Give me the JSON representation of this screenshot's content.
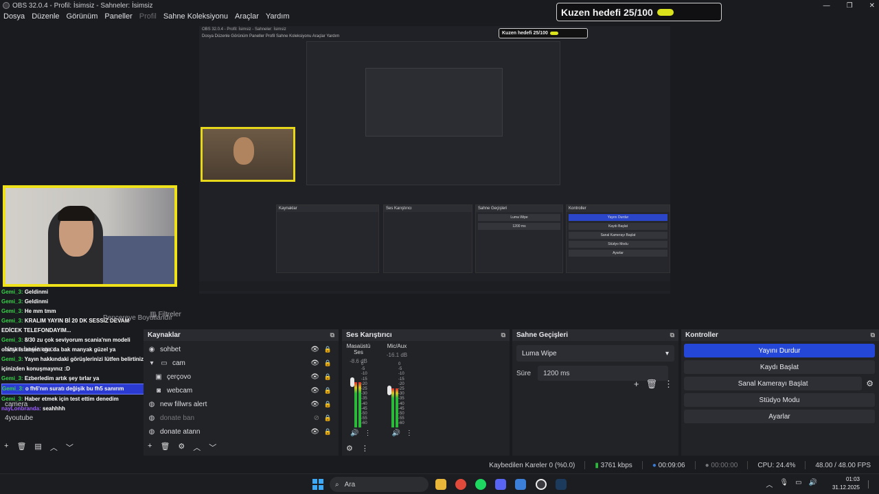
{
  "window": {
    "title": "OBS 32.0.4 - Profil: İsimsiz - Sahneler: İsimsiz",
    "controls": [
      "—",
      "❐",
      "✕"
    ]
  },
  "menu": {
    "items": [
      "Dosya",
      "Düzenle",
      "Görünüm",
      "Paneller",
      "Profil",
      "Sahne Koleksiyonu",
      "Araçlar",
      "Yardım"
    ]
  },
  "goal": {
    "label": "Kuzen hedefi 25/100",
    "current": 25,
    "target": 100,
    "bar_color": "#d9e21a"
  },
  "nested_preview": {
    "title": "OBS 32.0.4 - Profil: İsimsiz - Sahneler: İsimsiz",
    "menu": "Dosya  Düzenle  Görünüm  Paneller  Profil  Sahne Koleksiyonu  Araçlar  Yardım",
    "goal_label": "Kuzen hedefi 25/100",
    "controls_header": "Kontroller",
    "buttons": [
      "Yayını Durdur",
      "Kaydı Başlat",
      "Sanal Kamerayı Başlat",
      "Stüdyo Modu",
      "Ayarlar"
    ],
    "sources_header": "Kaynaklar",
    "mixer_header": "Ses Karıştırıcı",
    "transitions_header": "Sahne Geçişleri",
    "transition_value": "Luma Wipe",
    "duration_value": "1200 ms"
  },
  "chat": {
    "messages": [
      {
        "user": "Gemi_3:",
        "text": "Geldinmi"
      },
      {
        "user": "Gemi_3:",
        "text": "Geldinmi"
      },
      {
        "user": "Gemi_3:",
        "text": "He mm tmm"
      },
      {
        "user": "Gemi_3:",
        "text": "KRALIM YAYIN Bİ 20 DK SESSİZ DEVAM EDİCEK TELEFONDAYIM..."
      },
      {
        "user": "Gemi_3:",
        "text": "8/30 zu çok seviyorum scania'nın modeli olarak istersen ona da bak manyak güzel ya"
      },
      {
        "user": "Gemi_3:",
        "text": "Yayın hakkındaki görüşlerinizi lütfen belirtiniz içinizden konuşmayınız :D"
      },
      {
        "user": "Gemi_3:",
        "text": "Ezberledim artık şey tırlar ya"
      },
      {
        "user": "Gemi_3:",
        "text": "o fh6'nın suratı değişik bu fh5 sanırım"
      },
      {
        "user": "Gemi_3:",
        "text": "Haber etmek için test ettim denedim"
      },
      {
        "user": "nayLonbranda:",
        "text": "seahhhh"
      }
    ]
  },
  "docks": {
    "tab_resize_label": "Pencereye Boyutlandır",
    "filters_label": "Filtreler",
    "scenes": [
      "Yayın başlangıcı",
      "camera",
      "4youtube"
    ],
    "sources_header": "Kaynaklar",
    "sources": [
      {
        "name": "sohbet",
        "icon": "chat-icon",
        "indent": 0,
        "visible": true
      },
      {
        "name": "cam",
        "icon": "folder-icon",
        "indent": 0,
        "visible": true
      },
      {
        "name": "çerçovo",
        "icon": "image-icon",
        "indent": 1,
        "visible": true
      },
      {
        "name": "webcam",
        "icon": "camera-icon",
        "indent": 1,
        "visible": true
      },
      {
        "name": "new fillwrs alert",
        "icon": "browser-icon",
        "indent": 0,
        "visible": true
      },
      {
        "name": "donate ban",
        "icon": "browser-icon",
        "indent": 0,
        "visible": false
      },
      {
        "name": "donate atann",
        "icon": "browser-icon",
        "indent": 0,
        "visible": true
      }
    ],
    "mixer_header": "Ses Karıştırıcı",
    "mixer": [
      {
        "name": "Masaüstü Ses",
        "db": "-8.6 dB",
        "level": 0.7
      },
      {
        "name": "Mic/Aux",
        "db": "-16.1 dB",
        "level": 0.6
      }
    ],
    "meter_scale": [
      "0",
      "-5",
      "-10",
      "-15",
      "-20",
      "-25",
      "-30",
      "-35",
      "-40",
      "-45",
      "-50",
      "-55",
      "-60"
    ],
    "transitions_header": "Sahne Geçişleri",
    "transition_value": "Luma Wipe",
    "duration_label": "Süre",
    "duration_value": "1200 ms",
    "controls_header": "Kontroller",
    "controls": {
      "stop_stream": "Yayını Durdur",
      "start_record": "Kaydı Başlat",
      "start_vcam": "Sanal Kamerayı Başlat",
      "studio_mode": "Stüdyo Modu",
      "settings": "Ayarlar"
    },
    "accent_color": "#2447d8"
  },
  "status": {
    "dropped": "Kaybedilen Kareler 0 (%0.0)",
    "bitrate": "3761 kbps",
    "stream_time": "00:09:06",
    "record_time": "00:00:00",
    "cpu": "CPU: 24.4%",
    "fps": "48.00 / 48.00 FPS"
  },
  "taskbar": {
    "search_placeholder": "Ara",
    "time": "01:03",
    "date": "31.12.2025"
  }
}
